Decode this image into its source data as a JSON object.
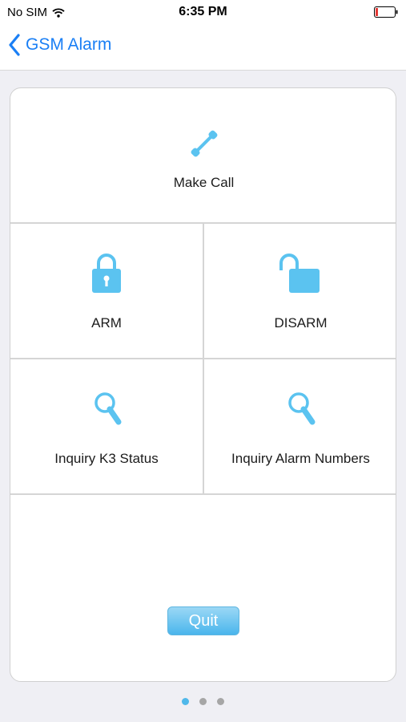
{
  "status_bar": {
    "carrier": "No SIM",
    "time": "6:35 PM",
    "battery_color": "#e53935"
  },
  "nav": {
    "back_label": "GSM Alarm"
  },
  "menu": {
    "make_call": "Make Call",
    "arm": "ARM",
    "disarm": "DISARM",
    "inquiry_status": "Inquiry K3 Status",
    "inquiry_numbers": "Inquiry Alarm Numbers",
    "quit": "Quit"
  },
  "icons": {
    "make_call": "phone-icon",
    "arm": "lock-closed-icon",
    "disarm": "lock-open-icon",
    "inquiry_status": "magnifier-icon",
    "inquiry_numbers": "magnifier-icon"
  },
  "colors": {
    "accent": "#1a7ff5",
    "icon": "#5bc3f0"
  },
  "pager": {
    "pages": 3,
    "current": 1
  }
}
